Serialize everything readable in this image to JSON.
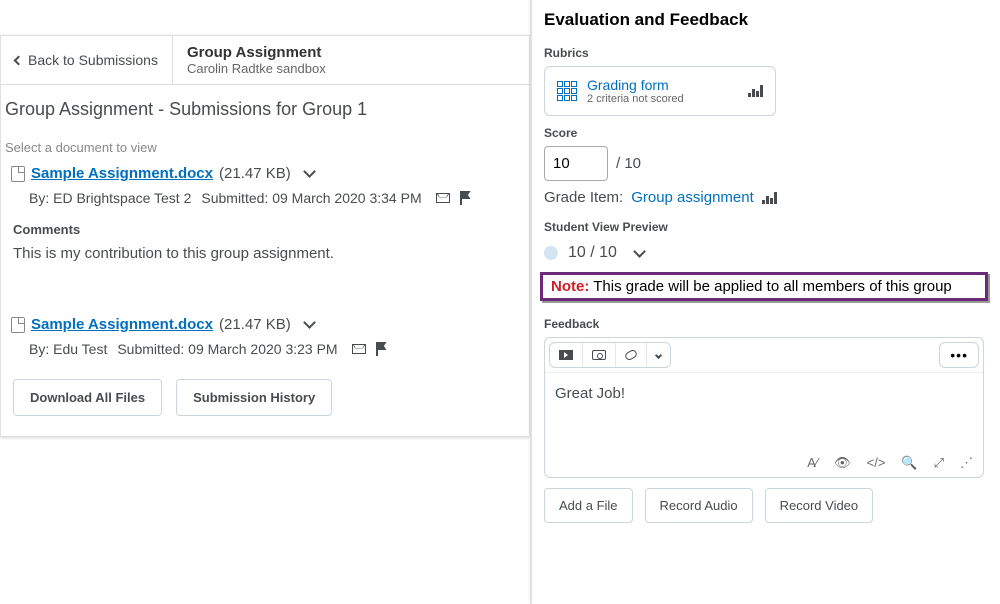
{
  "left": {
    "back_label": "Back to Submissions",
    "assignment_title": "Group Assignment",
    "assignment_sub": "Carolin Radtke sandbox",
    "page_heading": "Group Assignment - Submissions for Group 1",
    "select_doc_label": "Select a document to view",
    "submissions": [
      {
        "file_name": "Sample Assignment.docx",
        "file_size": "(21.47 KB)",
        "by_label": "By: ED Brightspace Test 2",
        "submitted_label": "Submitted: 09 March 2020 3:34 PM",
        "comments_label": "Comments",
        "comments_body": "This is my contribution to this group assignment."
      },
      {
        "file_name": "Sample Assignment.docx",
        "file_size": "(21.47 KB)",
        "by_label": "By: Edu Test",
        "submitted_label": "Submitted: 09 March 2020 3:23 PM"
      }
    ],
    "download_label": "Download All Files",
    "history_label": "Submission History"
  },
  "right": {
    "heading": "Evaluation and Feedback",
    "rubrics_label": "Rubrics",
    "rubric_link": "Grading form",
    "rubric_sub": "2 criteria not scored",
    "score_label": "Score",
    "score_value": "10",
    "score_max": "/ 10",
    "grade_item_label": "Grade Item:",
    "grade_item_link": "Group assignment",
    "preview_label": "Student View Preview",
    "preview_value": "10 / 10",
    "note_label": "Note:",
    "note_text": "This grade will be applied to all members of this group",
    "feedback_label": "Feedback",
    "editor_body": "Great Job!",
    "add_file_label": "Add a File",
    "record_audio_label": "Record Audio",
    "record_video_label": "Record Video"
  }
}
